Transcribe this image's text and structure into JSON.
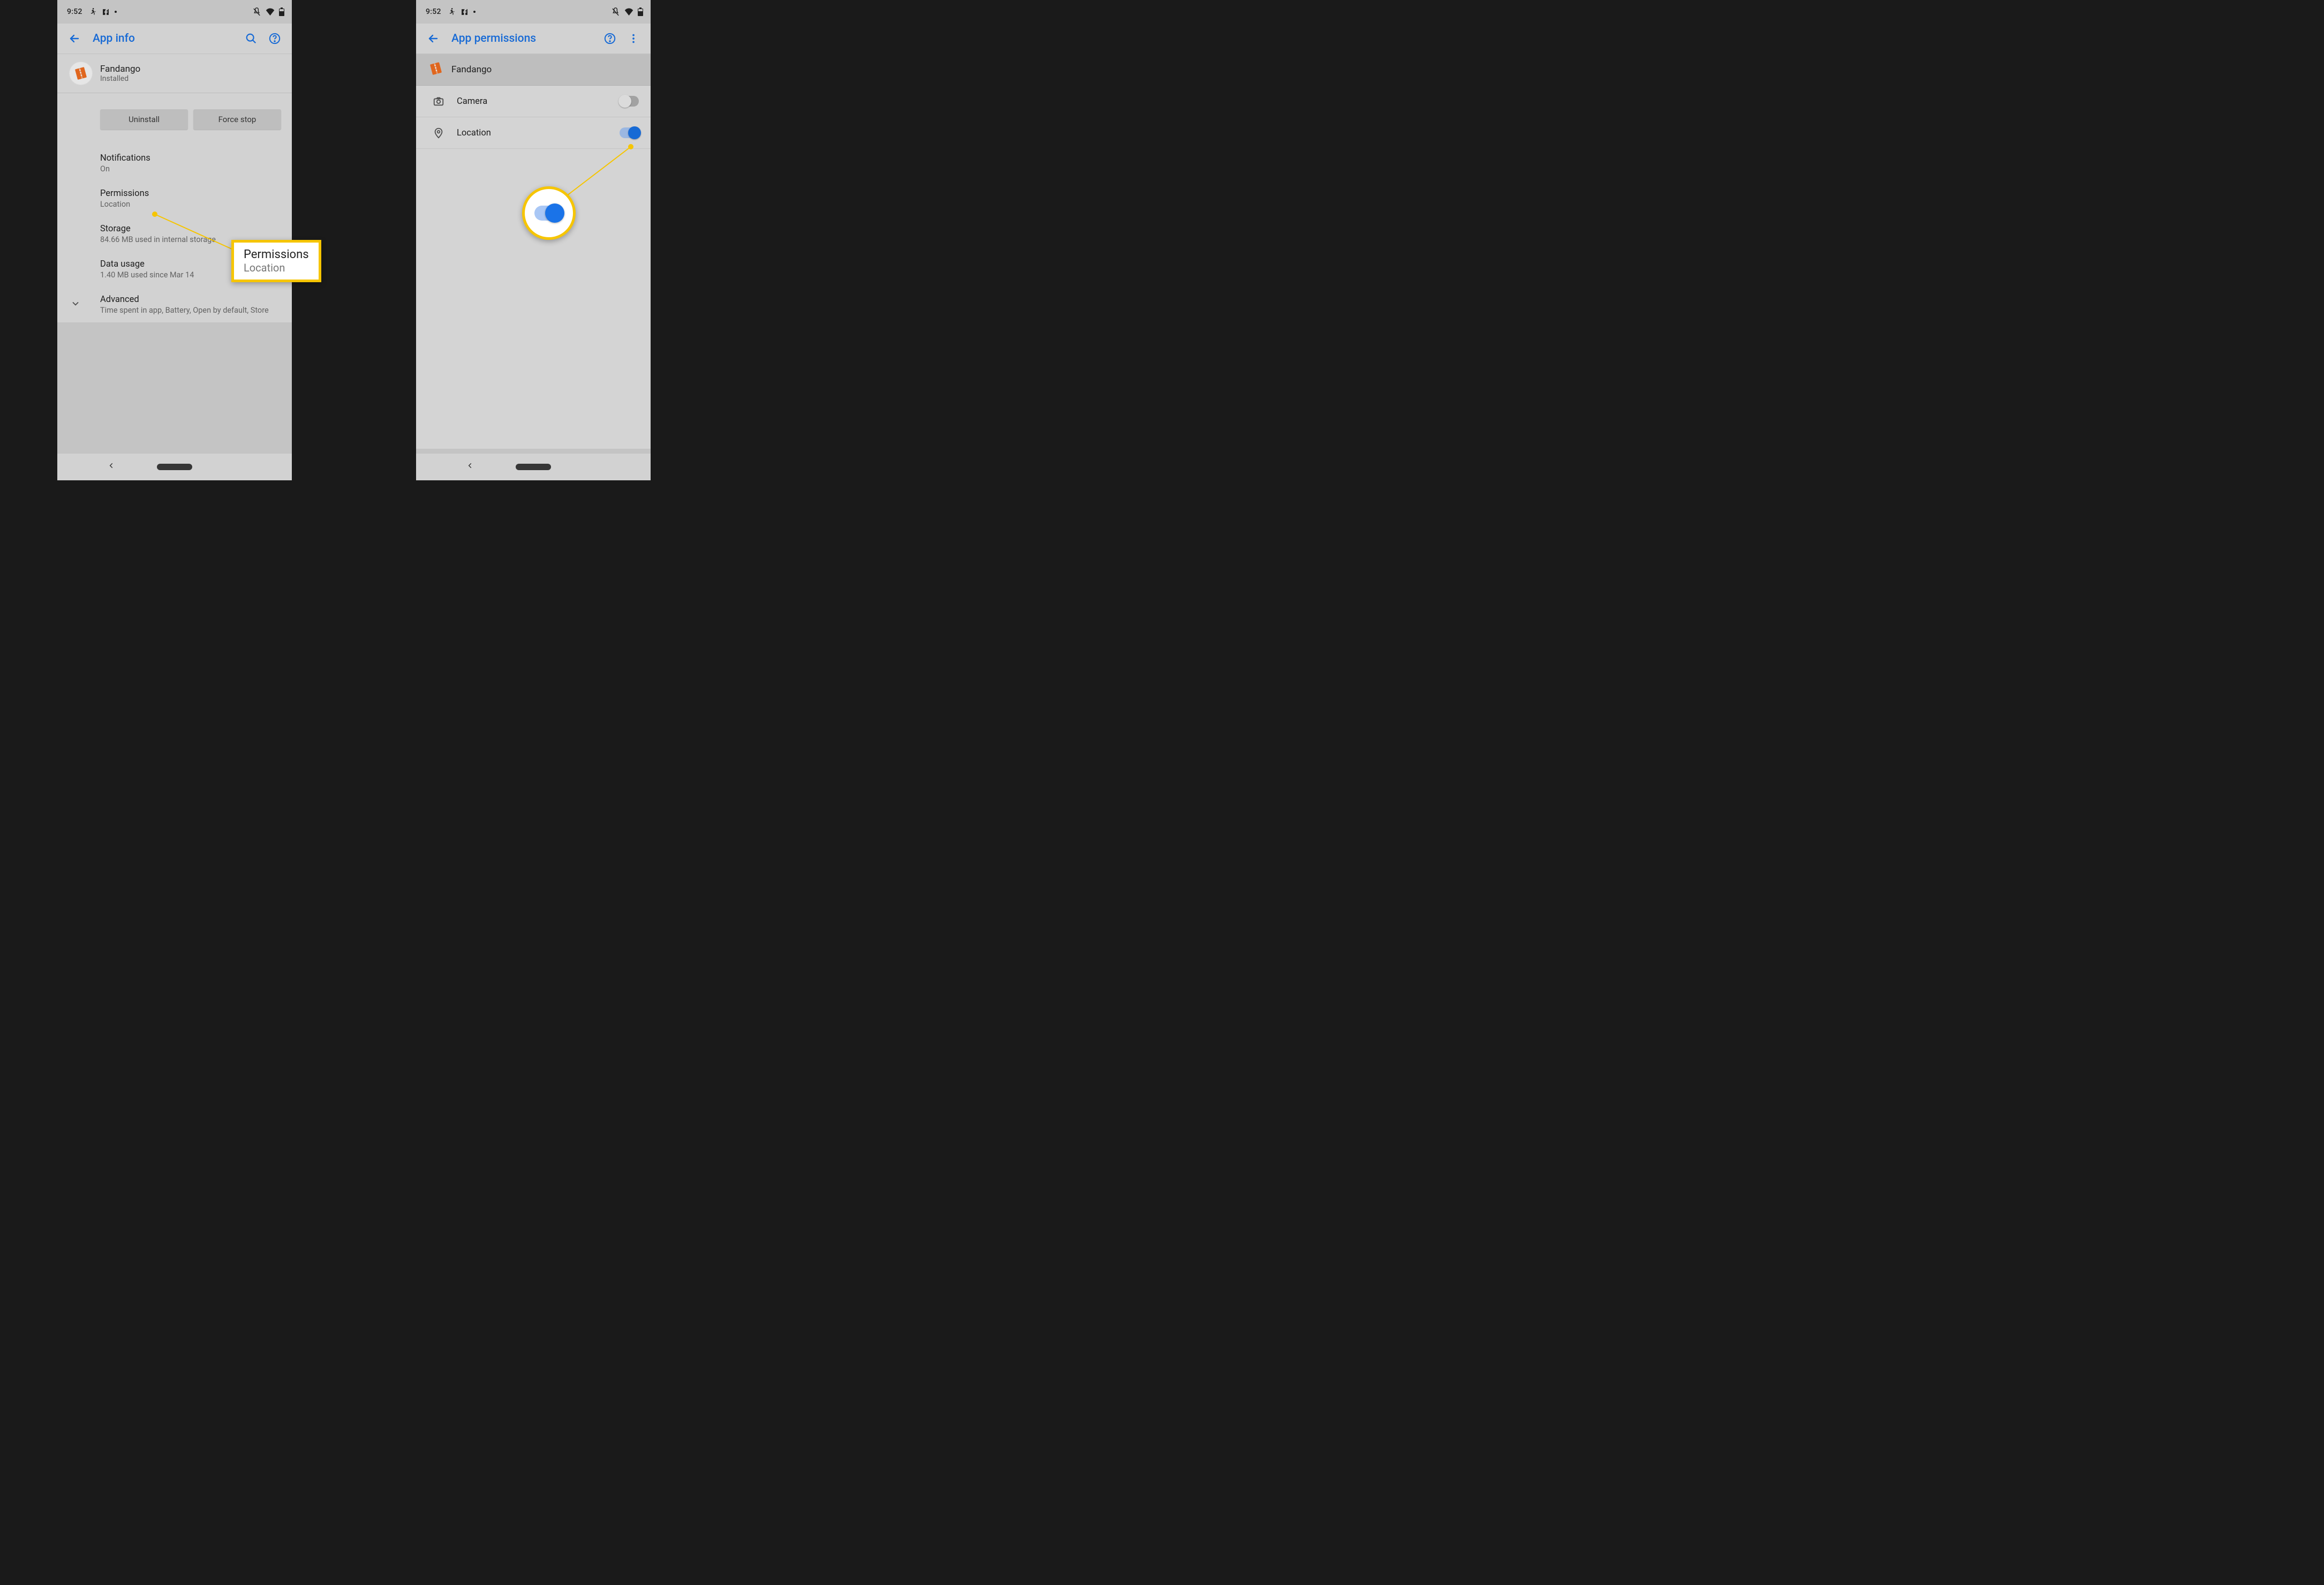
{
  "status": {
    "time": "9:52"
  },
  "screenA": {
    "title": "App info",
    "app_name": "Fandango",
    "app_status": "Installed",
    "uninstall": "Uninstall",
    "force_stop": "Force stop",
    "notifications": {
      "title": "Notifications",
      "sub": "On"
    },
    "permissions": {
      "title": "Permissions",
      "sub": "Location"
    },
    "storage": {
      "title": "Storage",
      "sub": "84.66 MB used in internal storage"
    },
    "data": {
      "title": "Data usage",
      "sub": "1.40 MB used since Mar 14"
    },
    "advanced": {
      "title": "Advanced",
      "sub": "Time spent in app, Battery, Open by default, Store"
    }
  },
  "screenB": {
    "title": "App permissions",
    "app_name": "Fandango",
    "perms": {
      "camera": {
        "label": "Camera",
        "on": false
      },
      "location": {
        "label": "Location",
        "on": true
      }
    }
  },
  "calloutA": {
    "title": "Permissions",
    "sub": "Location"
  }
}
